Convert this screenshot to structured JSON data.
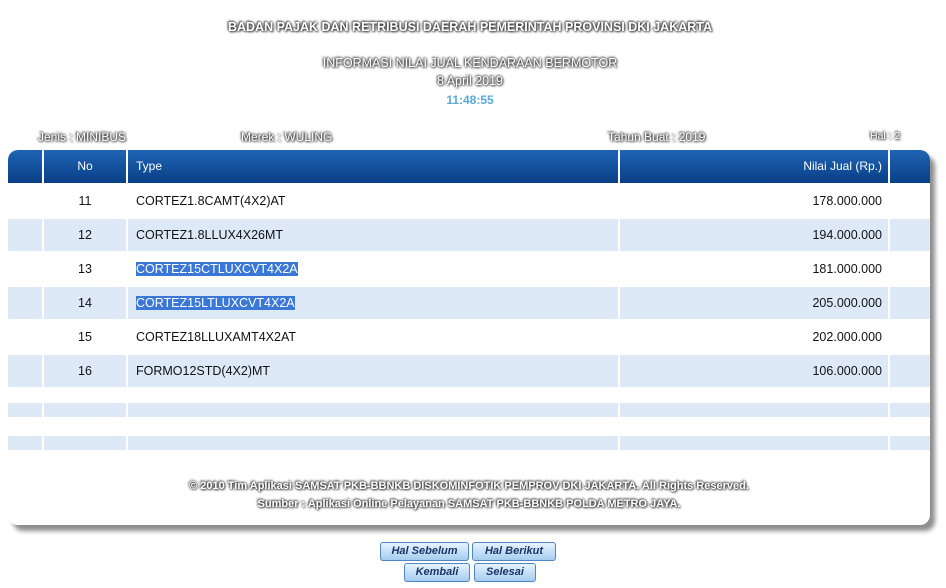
{
  "header": {
    "agency": "BADAN PAJAK DAN RETRIBUSI DAERAH PEMERINTAH PROVINSI DKI JAKARTA",
    "title": "INFORMASI NILAI JUAL KENDARAAN BERMOTOR",
    "date": "8 April 2019",
    "time": "11:48:55"
  },
  "meta": {
    "jenis": "Jenis : MINIBUS",
    "merek": "Merek : WULING",
    "tahun": "Tahun Buat : 2019",
    "hal": "Hal : 2"
  },
  "table": {
    "columns": {
      "no": "No",
      "type": "Type",
      "value": "Nilai Jual (Rp.)"
    },
    "rows": [
      {
        "no": "11",
        "type": "CORTEZ1.8CAMT(4X2)AT",
        "value": "178.000.000",
        "selected": false
      },
      {
        "no": "12",
        "type": "CORTEZ1.8LLUX4X26MT",
        "value": "194.000.000",
        "selected": false
      },
      {
        "no": "13",
        "type": "CORTEZ15CTLUXCVT4X2A",
        "value": "181.000.000",
        "selected": true
      },
      {
        "no": "14",
        "type": "CORTEZ15LTLUXCVT4X2A",
        "value": "205.000.000",
        "selected": true
      },
      {
        "no": "15",
        "type": "CORTEZ18LLUXAMT4X2AT",
        "value": "202.000.000",
        "selected": false
      },
      {
        "no": "16",
        "type": "FORMO12STD(4X2)MT",
        "value": "106.000.000",
        "selected": false
      }
    ]
  },
  "footer": {
    "copyright": "© 2010 Tim Aplikasi SAMSAT PKB-BBNKB DISKOMINFOTIK PEMPROV DKI JAKARTA. All Rights Reserved.",
    "source": "Sumber : Aplikasi Online Pelayanan SAMSAT PKB-BBNKB POLDA METRO JAYA."
  },
  "buttons": {
    "prev": "Hal Sebelum",
    "next": "Hal Berikut",
    "back": "Kembali",
    "done": "Selesai"
  },
  "colors": {
    "header_blue": "#0a3f86",
    "row_shade": "#dde9f7",
    "selection": "#3a77d6",
    "time": "#5aa9d8"
  }
}
